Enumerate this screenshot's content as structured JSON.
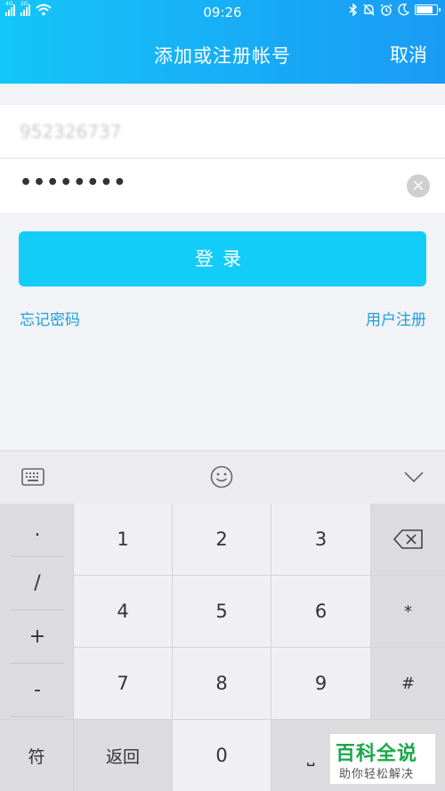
{
  "status_bar": {
    "signal1_tag": "4G",
    "signal2_tag": "2G",
    "time": "09:26",
    "battery_level": 0.8
  },
  "nav": {
    "title": "添加或注册帐号",
    "cancel_label": "取消"
  },
  "form": {
    "account_value": "952326737",
    "password_value": "••••••••",
    "clear_label": "×",
    "login_label": "登录",
    "forgot_label": "忘记密码",
    "register_label": "用户注册"
  },
  "keyboard": {
    "symbols": [
      ".",
      "/",
      "+",
      "-"
    ],
    "digits": [
      "1",
      "2",
      "3",
      "4",
      "5",
      "6",
      "7",
      "8",
      "9",
      "0"
    ],
    "right_keys": [
      "*",
      "#"
    ],
    "fu_label": "符",
    "back_label": "返回",
    "space_label": "⎵"
  },
  "watermark": {
    "title": "百科全说",
    "subtitle": "助你轻松解决"
  },
  "colors": {
    "header_gradient_start": "#14c6f9",
    "header_gradient_end": "#1a9cf4",
    "login_button": "#12cdf8",
    "link": "#1f9fd8"
  }
}
